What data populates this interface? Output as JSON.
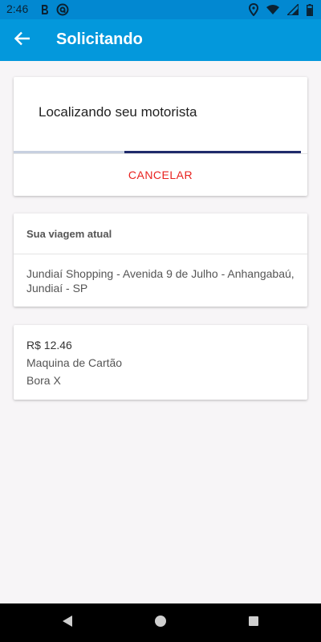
{
  "status_bar": {
    "time": "2:46",
    "icons": [
      "b-icon",
      "at-icon",
      "location-icon",
      "wifi-icon",
      "signal-icon",
      "battery-icon"
    ]
  },
  "app_bar": {
    "title": "Solicitando",
    "back_icon": "arrow-back-icon",
    "color": "#0398dc"
  },
  "locating_card": {
    "text": "Localizando seu motorista",
    "cancel_label": "CANCELAR",
    "cancel_color": "#e8221f"
  },
  "trip_card": {
    "header": "Sua viagem atual",
    "address": "Jundiaí Shopping - Avenida 9 de Julho - Anhangabaú, Jundiaí - SP"
  },
  "payment_card": {
    "price": "R$ 12.46",
    "method": "Maquina de Cartão",
    "service": "Bora X"
  },
  "nav_bar": {
    "back_icon": "triangle-back-icon",
    "home_icon": "circle-home-icon",
    "recents_icon": "square-recents-icon"
  }
}
